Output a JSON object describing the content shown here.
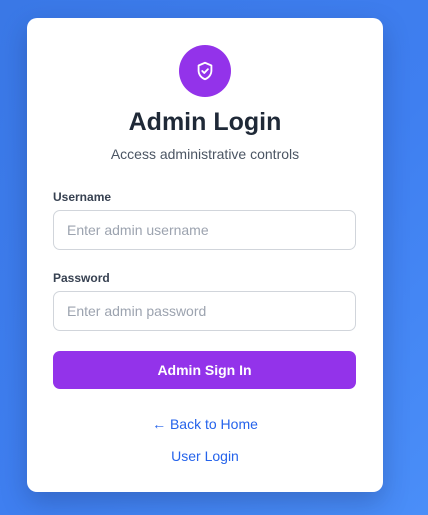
{
  "colors": {
    "background_gradient": [
      "#3a78e6",
      "#4a8ef8"
    ],
    "accent": "#9333ea",
    "link": "#2563eb",
    "title": "#1f2937"
  },
  "header": {
    "icon": "shield-check-icon",
    "title": "Admin Login",
    "subtitle": "Access administrative controls"
  },
  "form": {
    "username": {
      "label": "Username",
      "value": "",
      "placeholder": "Enter admin username"
    },
    "password": {
      "label": "Password",
      "value": "",
      "placeholder": "Enter admin password"
    },
    "submit_label": "Admin Sign In"
  },
  "links": {
    "back_home": "← Back to Home",
    "user_login": "User Login"
  }
}
